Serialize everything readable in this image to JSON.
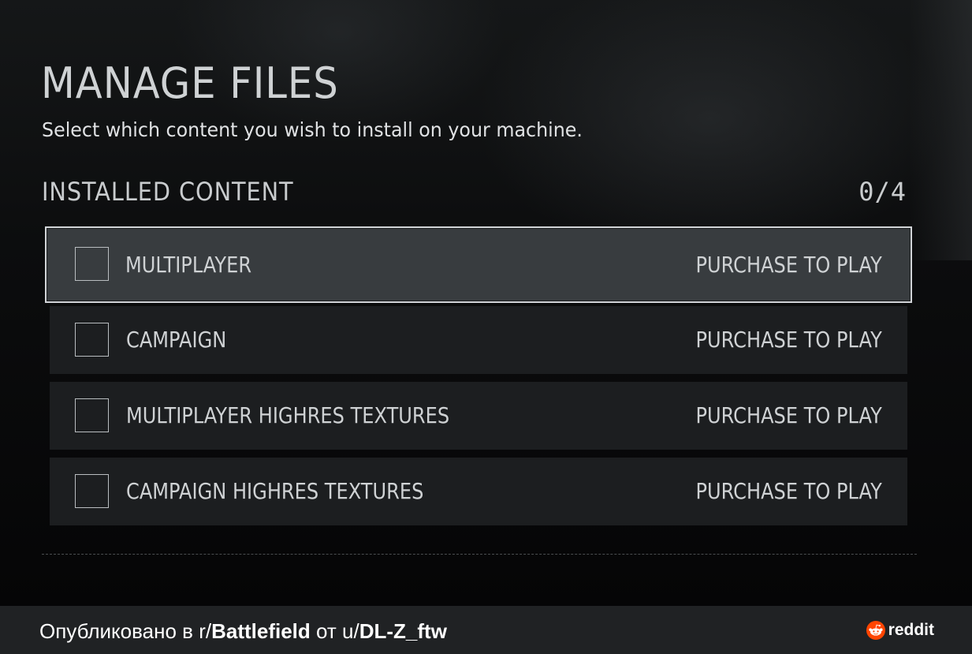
{
  "header": {
    "title": "MANAGE FILES",
    "subtitle": "Select which content you wish to install on your machine."
  },
  "installed_content": {
    "title": "INSTALLED CONTENT",
    "count": "0/4",
    "items": [
      {
        "label": "MULTIPLAYER",
        "status": "PURCHASE TO PLAY",
        "checked": false,
        "selected": true
      },
      {
        "label": "CAMPAIGN",
        "status": "PURCHASE TO PLAY",
        "checked": false,
        "selected": false
      },
      {
        "label": "MULTIPLAYER HIGHRES TEXTURES",
        "status": "PURCHASE TO PLAY",
        "checked": false,
        "selected": false
      },
      {
        "label": "CAMPAIGN HIGHRES TEXTURES",
        "status": "PURCHASE TO PLAY",
        "checked": false,
        "selected": false
      }
    ]
  },
  "footer": {
    "prefix": "Опубликовано в r/",
    "subreddit": "Battlefield",
    "middle": " от u/",
    "user": "DL-Z_ftw",
    "brand": "reddit"
  },
  "colors": {
    "selected_row": "#383c3f",
    "row": "#1c1e20",
    "selected_border": "#d2d5d8",
    "reddit_orange": "#ff4500"
  }
}
